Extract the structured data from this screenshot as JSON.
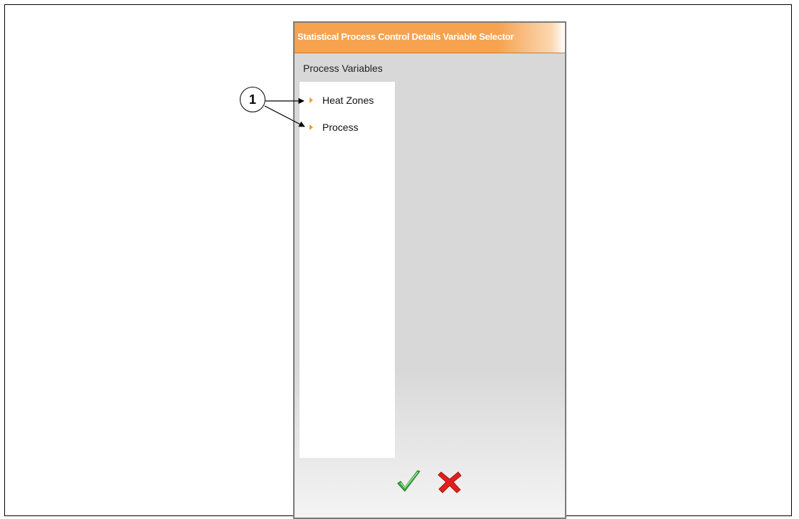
{
  "window": {
    "title": "Statistical Process Control Details Variable Selector"
  },
  "panel": {
    "heading": "Process Variables",
    "items": [
      {
        "label": "Heat Zones",
        "icon": "orange-triangle-right"
      },
      {
        "label": "Process",
        "icon": "orange-triangle-right"
      }
    ]
  },
  "footer": {
    "ok_icon": "green-checkmark-icon",
    "cancel_icon": "red-x-icon"
  },
  "callout": {
    "number": "1"
  },
  "colors": {
    "title_bar": "#f7a24f",
    "arrow": "#f29b30",
    "ok": "#3aa83a",
    "cancel": "#e0201b"
  }
}
